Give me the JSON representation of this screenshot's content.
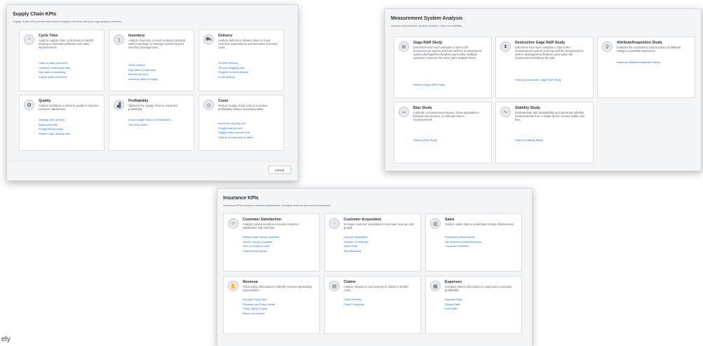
{
  "supply_chain": {
    "title": "Supply Chain KPIs",
    "subtitle": "Supply chain KPIs provide data-driven insights into how well your organization performs.",
    "cancel_label": "Cancel",
    "cards": [
      {
        "icon": "speedometer-icon",
        "glyph": "◔",
        "title": "Cycle Time",
        "desc": "Analyze supply chain cycle times to identify existing or potential problems and make improvements.",
        "links": [
          "Cash-to-cash cycle time",
          "Customer order cycle time",
          "Day sales outstanding",
          "Supply chain cycle time"
        ]
      },
      {
        "icon": "inventory-can-icon",
        "glyph": "▯",
        "title": "Inventory",
        "desc": "Analyze inventory to meet customer demand without spoilage or damage caused by poor inventory management.",
        "links": [
          "Stock rotation",
          "Day sales of inventory",
          "Months on hand",
          "Inventory days of supply"
        ]
      },
      {
        "icon": "delivery-truck-icon",
        "glyph": "⛟",
        "title": "Delivery",
        "desc": "Analyze defects in delivery times to meet customer expectations and decrease inventory costs.",
        "links": [
          "On-time delivery",
          "On-time shipping rate",
          "Supplier on-time delivery",
          "In-full delivery"
        ]
      },
      {
        "icon": "quality-ribbon-icon",
        "glyph": "✪",
        "title": "Quality",
        "desc": "Analyze problems in delivery quality to improve customer satisfaction.",
        "links": [
          "Damage-free delivery",
          "Back-order rate",
          "Freight bill accuracy",
          "Perfect order delivery rate"
        ]
      },
      {
        "icon": "profit-chart-icon",
        "glyph": "▟",
        "title": "Profitability",
        "desc": "Optimize the supply chain to maximize profitability.",
        "links": [
          "Gross margin return on investment",
          "Turn-earn index"
        ]
      },
      {
        "icon": "coins-icon",
        "glyph": "◎",
        "title": "Costs",
        "desc": "Reduce supply chain costs to increase profitability without increasing sales.",
        "links": [
          "Inventory carrying cost",
          "Freight cost per unit",
          "Supply chain cost per unit",
          "Cost as a proportion of sales"
        ]
      }
    ]
  },
  "msa": {
    "title": "Measurement System Analysis",
    "subtitle": "Assess measurement system variation, bias, and stability.",
    "cards": [
      {
        "icon": "gage-caliper-icon",
        "glyph": "⊞",
        "title": "Gage R&R Study",
        "desc": "Determine how much variation is due to the measurement system and how well the measurement system distinguishes between parts when multiple operators measure the same parts multiple times.",
        "links": [
          "Select a Gage R&R Study"
        ]
      },
      {
        "icon": "destructive-gage-icon",
        "glyph": "⧗",
        "title": "Destructive Gage R&R Study",
        "desc": "Determine how much variation is due to the measurement system and how well the measurement system distinguishes between parts when the measurement destroys the part.",
        "links": [
          "Select a Destructive Gage R&R Study"
        ]
      },
      {
        "icon": "magnifier-icon",
        "glyph": "⚲",
        "title": "Attribute/Inspection Study",
        "desc": "Evaluate the consistency and accuracy of attribute ratings or pass/fail inspections.",
        "links": [
          "Select an Attribute/Inspection Study"
        ]
      },
      {
        "icon": "bias-gauge-icon",
        "glyph": "⊸",
        "title": "Bias Study",
        "desc": "Calibrate a measurement device, show equivalence between two devices, or estimate bias in measurements.",
        "links": [
          "Select a Bias Study"
        ]
      },
      {
        "icon": "stability-wave-icon",
        "glyph": "∿",
        "title": "Stability Study",
        "desc": "Estimate bias and repeatability and determine whether measurements from a single device remain stable over time.",
        "links": [
          "Select a Stability Study"
        ]
      }
    ]
  },
  "insurance": {
    "title": "Insurance KPIs",
    "subtitle": "Insurance KPIs improve customer satisfaction, increase revenue and control expenses.",
    "cards": [
      {
        "icon": "satisfaction-survey-icon",
        "glyph": "☺",
        "title": "Customer Satisfaction",
        "desc": "Analyze survey results to increase customer satisfaction and retention.",
        "links": [
          "Rating Scale Survey Question",
          "Yes/No Survey Question",
          "Time to Settle a Claim",
          "Underwriting Speed"
        ]
      },
      {
        "icon": "acquisition-dots-icon",
        "glyph": "⁘",
        "title": "Customer Acquisition",
        "desc": "Increase customer acquisition to increase revenue and growth.",
        "links": [
          "Cost per Acquisition",
          "Number of Referrals",
          "Strike Rate",
          "New Business"
        ]
      },
      {
        "icon": "sales-bars-icon",
        "glyph": "▥",
        "title": "Sales",
        "desc": "Analyze sales data to understand broker effectiveness.",
        "links": [
          "Production versus Quota",
          "Top Brokers in Sales Revenue",
          "Customer Retention"
        ]
      },
      {
        "icon": "revenue-hand-icon",
        "glyph": "✋",
        "title": "Revenue",
        "desc": "Track policy information to identify revenue generating opportunities.",
        "links": [
          "Average Policy Size",
          "Revenue per Policy Holder",
          "Policy Sales Growth",
          "Return on Surplus"
        ]
      },
      {
        "icon": "claims-document-icon",
        "glyph": "▤",
        "title": "Claims",
        "desc": "Analyze frequency and severity of claims to predict costs.",
        "links": [
          "Claim Severity",
          "Claim Frequency"
        ]
      },
      {
        "icon": "expenses-calculator-icon",
        "glyph": "▦",
        "title": "Expenses",
        "desc": "Compare claims information to expenses to increase profitability.",
        "links": [
          "Expense Ratio",
          "Claims Ratio",
          "Loss Ratio"
        ]
      }
    ]
  },
  "stray_text": "ely"
}
